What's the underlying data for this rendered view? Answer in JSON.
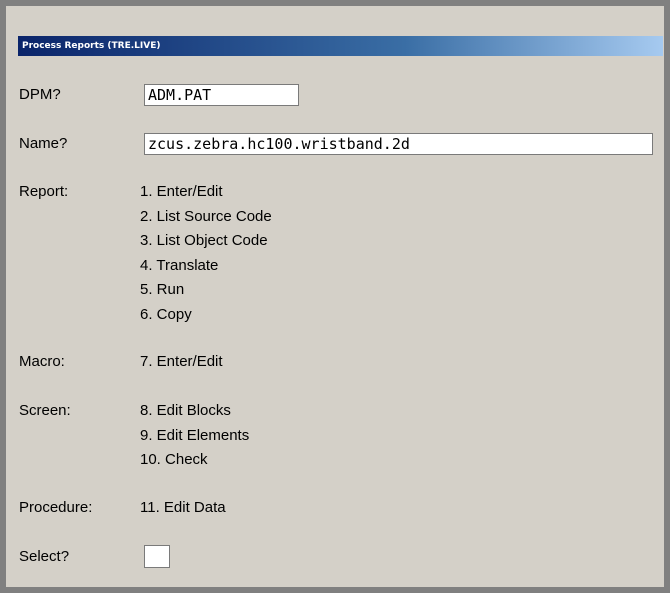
{
  "window": {
    "title": "Process Reports (TRE.LIVE)"
  },
  "form": {
    "dpm": {
      "label": "DPM?",
      "value": "ADM.PAT"
    },
    "name": {
      "label": "Name?",
      "value": "zcus.zebra.hc100.wristband.2d"
    },
    "select": {
      "label": "Select?",
      "value": ""
    }
  },
  "groups": {
    "report": {
      "label": "Report:",
      "options": [
        "1. Enter/Edit",
        "2. List Source Code",
        "3. List Object Code",
        "4. Translate",
        "5. Run",
        "6. Copy"
      ]
    },
    "macro": {
      "label": "Macro:",
      "options": [
        "7. Enter/Edit"
      ]
    },
    "screen": {
      "label": "Screen:",
      "options": [
        "8. Edit Blocks",
        "9. Edit Elements",
        "10. Check"
      ]
    },
    "procedure": {
      "label": "Procedure:",
      "options": [
        "11. Edit Data"
      ]
    }
  }
}
